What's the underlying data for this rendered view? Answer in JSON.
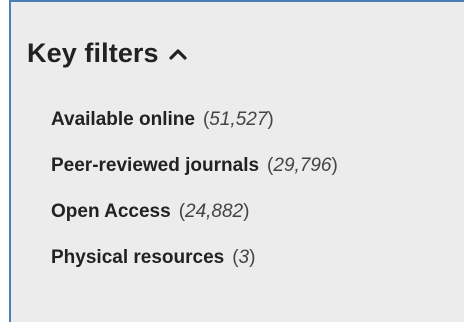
{
  "filters": {
    "title": "Key filters",
    "icon": "chevron-up-icon",
    "items": [
      {
        "label": "Available online",
        "count": "51,527"
      },
      {
        "label": "Peer-reviewed journals",
        "count": "29,796"
      },
      {
        "label": "Open Access",
        "count": "24,882"
      },
      {
        "label": "Physical resources",
        "count": "3"
      }
    ]
  },
  "colors": {
    "panel_background": "#ececec",
    "panel_border": "#4a7fb8",
    "text": "#222222"
  }
}
